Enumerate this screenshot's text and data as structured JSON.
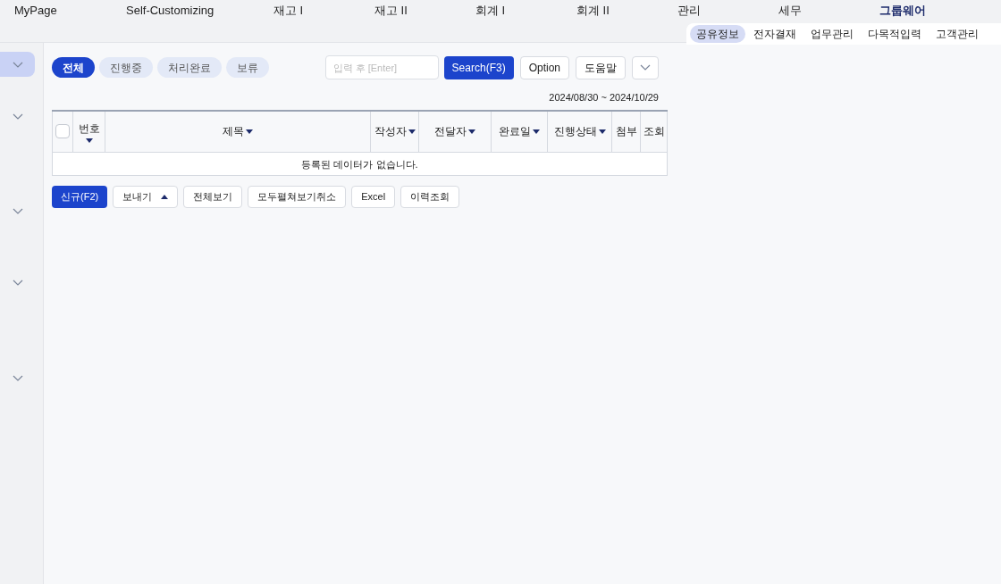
{
  "top_menu": [
    {
      "label": "MyPage",
      "bold": false
    },
    {
      "label": "Self-Customizing",
      "bold": false
    },
    {
      "label": "재고 I",
      "bold": false
    },
    {
      "label": "재고 II",
      "bold": false
    },
    {
      "label": "회계 I",
      "bold": false
    },
    {
      "label": "회계 II",
      "bold": false
    },
    {
      "label": "관리",
      "bold": false
    },
    {
      "label": "세무",
      "bold": false
    },
    {
      "label": "그룹웨어",
      "bold": true
    }
  ],
  "sub_menu": [
    {
      "label": "공유정보",
      "selected": true
    },
    {
      "label": "전자결재",
      "selected": false
    },
    {
      "label": "업무관리",
      "selected": false
    },
    {
      "label": "다목적입력",
      "selected": false
    },
    {
      "label": "고객관리",
      "selected": false
    }
  ],
  "sidebar": [
    {
      "selected": true
    },
    {
      "selected": false
    },
    {
      "selected": false
    },
    {
      "selected": false
    },
    {
      "selected": false
    }
  ],
  "filter_tabs": [
    {
      "label": "전체",
      "selected": true
    },
    {
      "label": "진행중",
      "selected": false
    },
    {
      "label": "처리완료",
      "selected": false
    },
    {
      "label": "보류",
      "selected": false
    }
  ],
  "search": {
    "placeholder": "입력 후 [Enter]"
  },
  "toolbar": [
    "Search(F3)",
    "Option",
    "도움말"
  ],
  "date_range": "2024/08/30 ~ 2024/10/29",
  "table": {
    "select_all": {
      "checked": false
    },
    "columns": [
      {
        "label": "번호",
        "sortable": true,
        "stacked": true
      },
      {
        "label": "제목",
        "sortable": true,
        "stacked": false
      },
      {
        "label": "작성자",
        "sortable": true,
        "stacked": false
      },
      {
        "label": "전달자",
        "sortable": true,
        "stacked": false
      },
      {
        "label": "완료일",
        "sortable": true,
        "stacked": false
      },
      {
        "label": "진행상태",
        "sortable": true,
        "stacked": false
      },
      {
        "label": "첨부",
        "sortable": false
      },
      {
        "label": "조회",
        "sortable": false
      }
    ],
    "empty_message": "등록된 데이터가 없습니다."
  },
  "bottom_buttons": [
    {
      "label": "신규(F2)",
      "kind": "primary"
    },
    {
      "label": "보내기",
      "kind": "dropdown"
    },
    {
      "label": "전체보기",
      "kind": "plain"
    },
    {
      "label": "모두펼쳐보기취소",
      "kind": "plain"
    },
    {
      "label": "Excel",
      "kind": "plain"
    },
    {
      "label": "이력조회",
      "kind": "plain"
    }
  ]
}
